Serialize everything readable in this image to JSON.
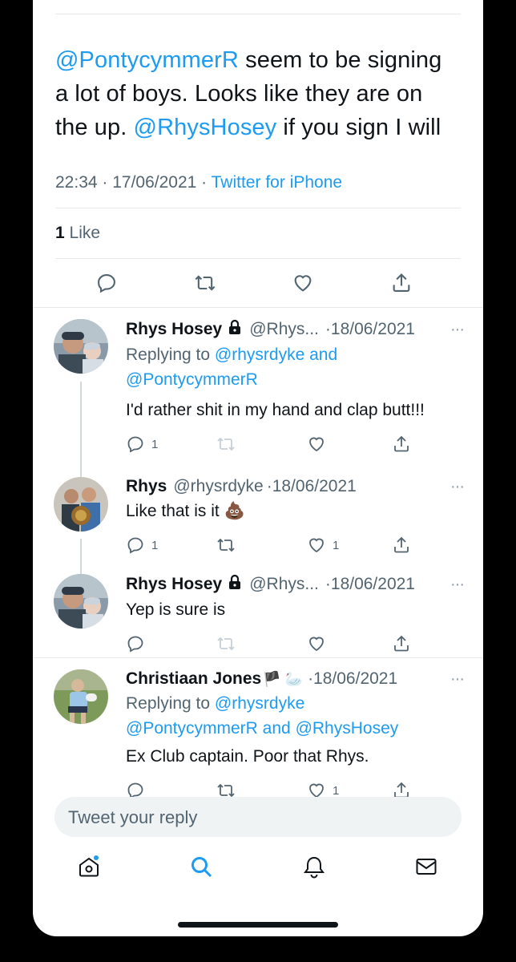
{
  "main_tweet": {
    "text_mention1": "@PontycymmerR",
    "text_part1": " seem to be signing a lot of boys. Looks like they are on the up. ",
    "text_mention2": "@RhysHosey",
    "text_part2": " if you sign I will",
    "time": "22:34",
    "date": "17/06/2021",
    "source": "Twitter for iPhone",
    "like_count": "1",
    "like_label": "Like"
  },
  "replies": [
    {
      "name": "Rhys Hosey",
      "handle": "@Rhys...",
      "date": "·18/06/2021",
      "replying_prefix": "Replying to ",
      "replying_to1": "@rhysrdyke",
      "replying_and": " and",
      "replying_to2": "@PontycymmerR",
      "text": "I'd rather shit in my hand and clap butt!!!",
      "reply_count": "1",
      "retweet_count": "",
      "like_count": ""
    },
    {
      "name": "Rhys",
      "handle": "@rhysrdyke",
      "date": "·18/06/2021",
      "text": "Like that is it 💩",
      "reply_count": "1",
      "retweet_count": "",
      "like_count": "1"
    },
    {
      "name": "Rhys Hosey",
      "handle": "@Rhys...",
      "date": "·18/06/2021",
      "text": "Yep is sure is",
      "reply_count": "",
      "retweet_count": "",
      "like_count": ""
    },
    {
      "name": "Christiaan Jones",
      "name_emoji": "🏴 🦢",
      "date": "·18/06/2021",
      "replying_prefix": "Replying to ",
      "replying_to1": "@rhysrdyke",
      "replying_to2": "@PontycymmerR",
      "replying_and": " and ",
      "replying_to3": "@RhysHosey",
      "text": "Ex Club captain. Poor that Rhys.",
      "reply_count": "",
      "retweet_count": "",
      "like_count": "1"
    }
  ],
  "reply_box": {
    "placeholder": "Tweet your reply"
  },
  "more_label": "···",
  "tabbar": {
    "icons": [
      "home-icon",
      "search-icon",
      "notifications-icon",
      "messages-icon"
    ]
  },
  "colors": {
    "accent": "#1d9bf0",
    "muted": "#536471",
    "text": "#0f1419"
  }
}
